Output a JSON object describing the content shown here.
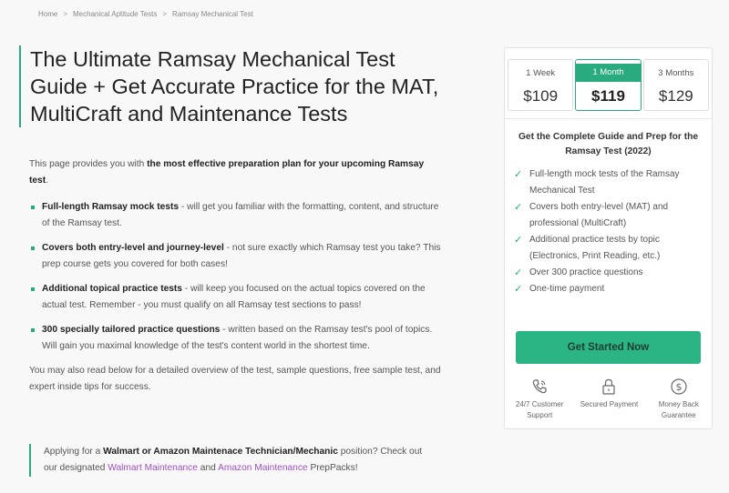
{
  "breadcrumb": {
    "home": "Home",
    "sep": ">",
    "level2": "Mechanical Aptitude Tests",
    "current": "Ramsay Mechanical Test"
  },
  "title": "The Ultimate Ramsay Mechanical Test Guide + Get Accurate Practice for the MAT, MultiCraft and Maintenance Tests",
  "intro": {
    "text1": "This page provides you with ",
    "bold": "the most effective preparation plan for your upcoming Ramsay test",
    "text2": "."
  },
  "bullets": [
    {
      "bold": "Full-length Ramsay mock tests",
      "text": " - will get you familiar with the formatting, content, and structure of the Ramsay test."
    },
    {
      "bold": "Covers both entry-level and journey-level",
      "text": " - not sure exactly which Ramsay test you take? This prep course gets you covered for both cases!"
    },
    {
      "bold": "Additional topical practice tests",
      "text": " - will keep you focused on the actual topics covered on the actual test. Remember - you must qualify on all Ramsay test sections to pass!"
    },
    {
      "bold": "300 specially tailored practice questions",
      "text": " - written based on the Ramsay test's pool of topics. Will gain you maximal knowledge of the test's content world in the shortest time."
    }
  ],
  "outro": "You may also read below for a detailed overview of the test, sample questions, free sample test, and expert inside tips for success.",
  "callout": {
    "text1": "Applying for a ",
    "bold": "Walmart or Amazon Maintenace Technician/Mechanic",
    "text2": " position? Check out our designated ",
    "link1": "Walmart Maintenance",
    "text3": " and ",
    "link2": "Amazon Maintenance",
    "text4": " PrepPacks!"
  },
  "pricing": {
    "plans": [
      {
        "duration": "1 Week",
        "price": "$109"
      },
      {
        "duration": "1 Month",
        "price": "$119"
      },
      {
        "duration": "3 Months",
        "price": "$129"
      }
    ],
    "heading": "Get the Complete Guide and Prep for the Ramsay Test (2022)",
    "features": [
      "Full-length mock tests of the Ramsay Mechanical Test",
      "Covers both entry-level (MAT) and professional (MultiCraft)",
      "Additional practice tests by topic (Electronics, Print Reading, etc.)",
      "Over 300 practice questions",
      "One-time payment"
    ],
    "check_glyph": "✓",
    "cta": "Get Started Now",
    "guarantees": [
      {
        "icon": "phone-icon",
        "label": "24/7 Customer Support"
      },
      {
        "icon": "lock-icon",
        "label": "Secured Payment"
      },
      {
        "icon": "dollar-icon",
        "label": "Money Back Guarantee"
      }
    ]
  },
  "colors": {
    "accent": "#2aaa7f",
    "cta": "#2bb585",
    "link": "#a14fc7"
  }
}
